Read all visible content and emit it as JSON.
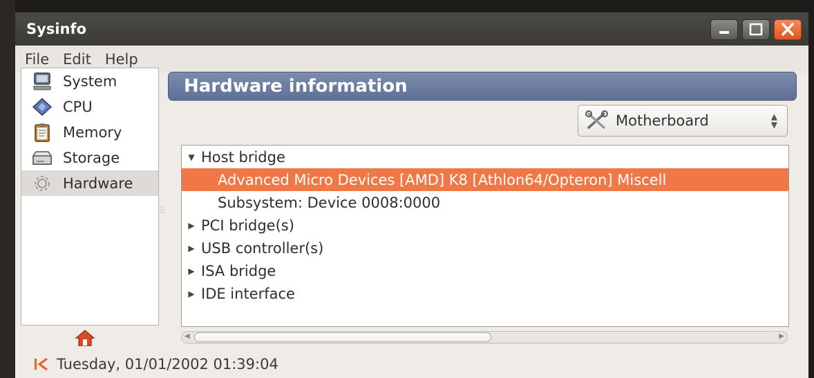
{
  "window": {
    "title": "Sysinfo"
  },
  "menu": [
    "File",
    "Edit",
    "Help"
  ],
  "sidebar": {
    "items": [
      {
        "label": "System",
        "icon": "monitor-icon"
      },
      {
        "label": "CPU",
        "icon": "cpu-chip-icon"
      },
      {
        "label": "Memory",
        "icon": "memory-clipboard-icon"
      },
      {
        "label": "Storage",
        "icon": "hard-drive-icon"
      },
      {
        "label": "Hardware",
        "icon": "gear-icon",
        "selected": true
      }
    ]
  },
  "header": {
    "title": "Hardware information"
  },
  "category_select": {
    "value": "Motherboard",
    "icon": "tools-icon"
  },
  "tree": {
    "rows": [
      {
        "label": "Host bridge",
        "level": 0,
        "expander": "expanded"
      },
      {
        "label": "Advanced Micro Devices [AMD] K8 [Athlon64/Opteron] Miscell",
        "level": 1,
        "selected": true
      },
      {
        "label": "Subsystem: Device 0008:0000",
        "level": 1
      },
      {
        "label": "PCI bridge(s)",
        "level": 0,
        "expander": "collapsed"
      },
      {
        "label": "USB controller(s)",
        "level": 0,
        "expander": "collapsed"
      },
      {
        "label": "ISA bridge",
        "level": 0,
        "expander": "collapsed"
      },
      {
        "label": "IDE interface",
        "level": 0,
        "expander": "collapsed"
      }
    ]
  },
  "status": {
    "datetime": "Tuesday, 01/01/2002 01:39:04"
  },
  "colors": {
    "selection": "#f07746",
    "header": "#6a7aa0",
    "close_button": "#e8602a"
  }
}
